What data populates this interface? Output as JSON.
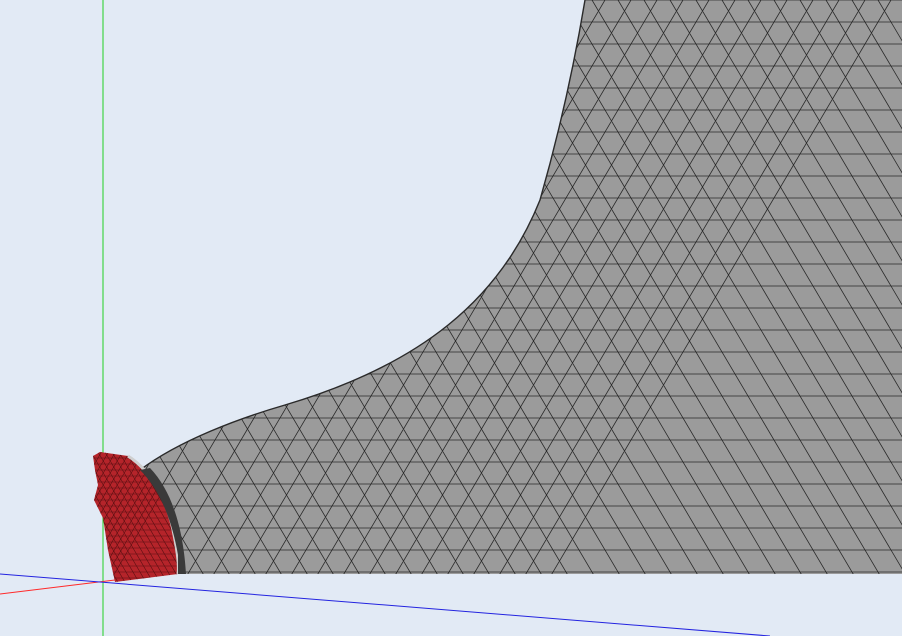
{
  "viewport": {
    "background_color": "#e2eaf5",
    "mesh_fill_color": "#9b9b9b",
    "mesh_edge_color": "#2a2a2a",
    "highlight_fill_color": "#b5242a",
    "highlight_edge_color": "#5a0f12"
  },
  "axes": {
    "x_axis": {
      "color": "#ff2a2a"
    },
    "y_axis": {
      "color": "#22d022"
    },
    "z_axis": {
      "color": "#2323e0"
    }
  },
  "mesh": {
    "element_type": "triangle",
    "highlighted_region": "left-end-face"
  }
}
